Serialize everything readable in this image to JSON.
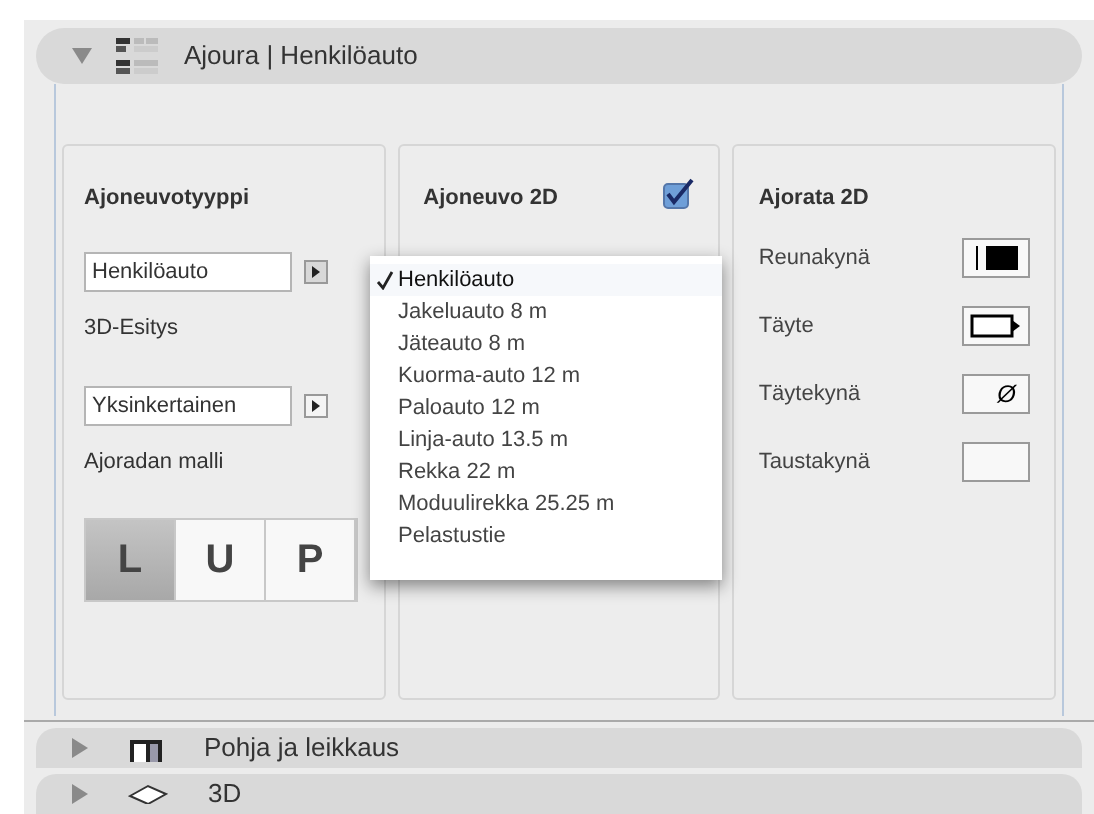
{
  "header": {
    "title": "Ajoura | Henkilöauto",
    "expanded": true
  },
  "vehicle_type": {
    "heading": "Ajoneuvotyyppi",
    "dropdown": {
      "value": "Henkilöauto"
    },
    "label_3d": "3D-Esitys",
    "dropdown_3d": {
      "value": "Yksinkertainen"
    },
    "model_label": "Ajoradan malli",
    "segments": [
      {
        "label": "L",
        "selected": true
      },
      {
        "label": "U",
        "selected": false
      },
      {
        "label": "P",
        "selected": false
      }
    ]
  },
  "vehicle_2d": {
    "heading": "Ajoneuvo 2D",
    "checked": true
  },
  "menu": {
    "items": [
      {
        "label": "Henkilöauto",
        "selected": true
      },
      {
        "label": "Jakeluauto 8 m",
        "selected": false
      },
      {
        "label": "Jäteauto 8 m",
        "selected": false
      },
      {
        "label": "Kuorma-auto 12 m",
        "selected": false
      },
      {
        "label": "Paloauto 12 m",
        "selected": false
      },
      {
        "label": "Linja-auto 13.5 m",
        "selected": false
      },
      {
        "label": "Rekka 22 m",
        "selected": false
      },
      {
        "label": "Moduulirekka 25.25 m",
        "selected": false
      },
      {
        "label": "Pelastustie",
        "selected": false
      }
    ]
  },
  "road_2d": {
    "heading": "Ajorata 2D",
    "rows": [
      {
        "label": "Reunakynä",
        "kind": "pen"
      },
      {
        "label": "Täyte",
        "kind": "fill"
      },
      {
        "label": "Täytekynä",
        "kind": "symbol",
        "symbol": "Ø"
      },
      {
        "label": "Taustakynä",
        "kind": "blank"
      }
    ]
  },
  "sections": [
    {
      "title": "Pohja ja leikkaus",
      "expanded": false,
      "kind": "plan"
    },
    {
      "title": "3D",
      "expanded": false,
      "kind": "box"
    }
  ]
}
